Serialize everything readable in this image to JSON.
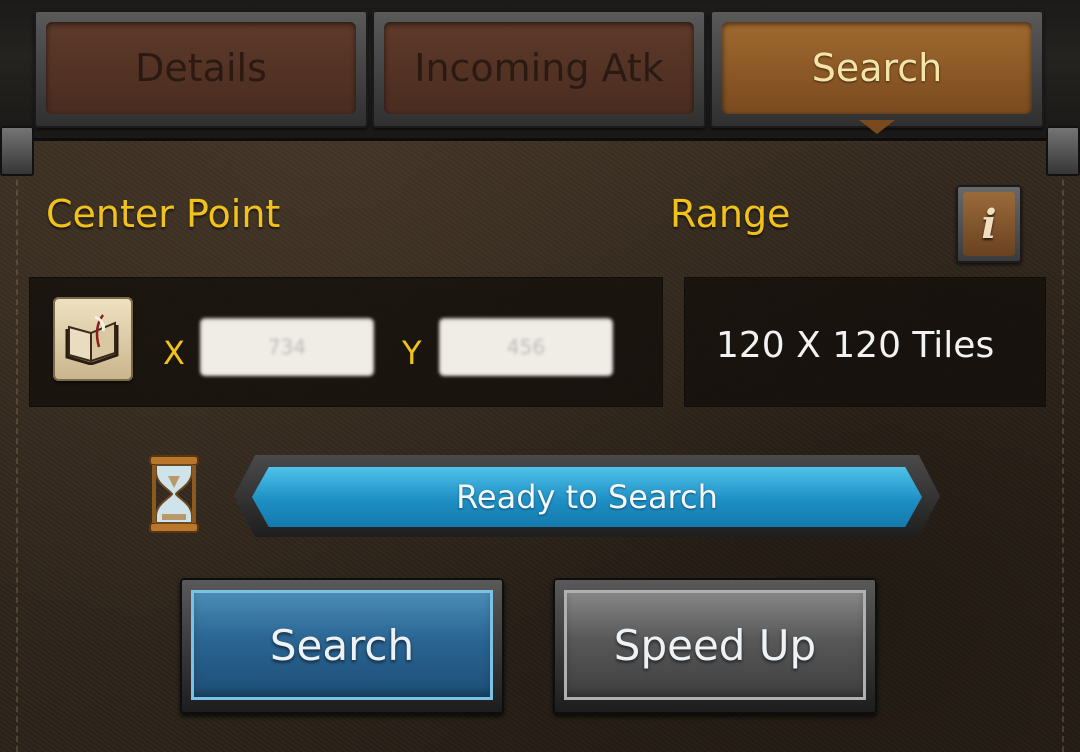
{
  "tabs": [
    {
      "label": "Details",
      "active": false
    },
    {
      "label": "Incoming Atk",
      "active": false
    },
    {
      "label": "Search",
      "active": true
    }
  ],
  "center_point": {
    "label": "Center Point",
    "x_label": "X",
    "y_label": "Y",
    "x_value": "734",
    "y_value": "456"
  },
  "range": {
    "label": "Range",
    "value": "120 X 120 Tiles"
  },
  "info_icon": "info-icon",
  "bookmark_icon": "book-icon",
  "status": {
    "text": "Ready to Search",
    "icon": "hourglass-icon"
  },
  "actions": {
    "search_label": "Search",
    "speed_up_label": "Speed Up"
  },
  "colors": {
    "accent_yellow": "#f1c21b",
    "progress_blue": "#1e8fc4",
    "tab_active": "#a06a30"
  }
}
